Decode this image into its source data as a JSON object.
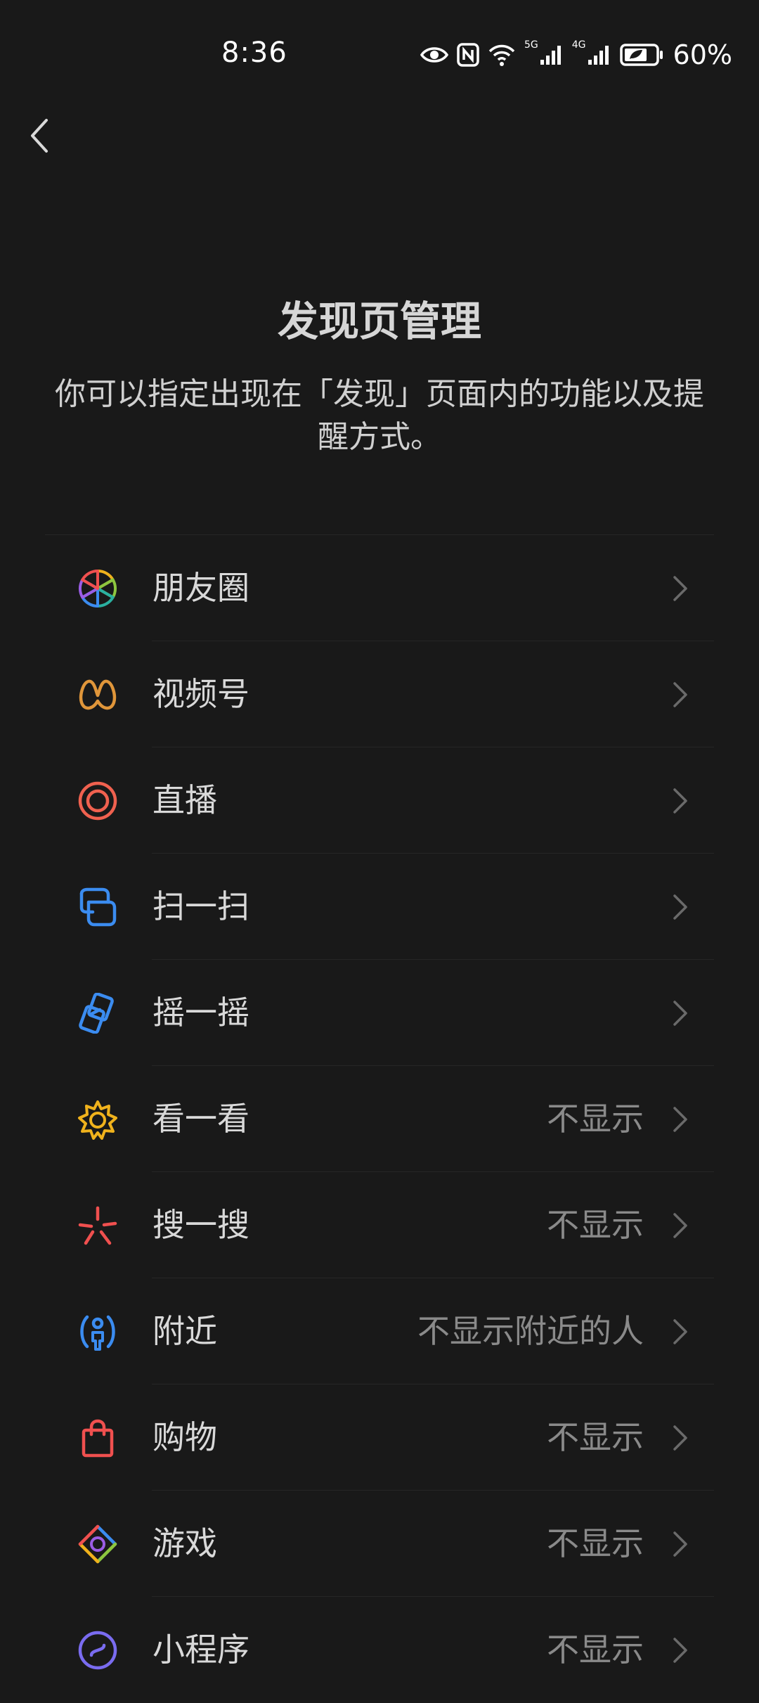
{
  "status_bar": {
    "time": "8:36",
    "battery_percent": "60%",
    "signal_1_label": "5G",
    "signal_2_label": "4G"
  },
  "header": {
    "title": "发现页管理",
    "description": "你可以指定出现在「发现」页面内的功能以及提醒方式。"
  },
  "items": [
    {
      "label": "朋友圈",
      "value": "",
      "icon": "moments-icon"
    },
    {
      "label": "视频号",
      "value": "",
      "icon": "channels-icon"
    },
    {
      "label": "直播",
      "value": "",
      "icon": "live-icon"
    },
    {
      "label": "扫一扫",
      "value": "",
      "icon": "scan-icon"
    },
    {
      "label": "摇一摇",
      "value": "",
      "icon": "shake-icon"
    },
    {
      "label": "看一看",
      "value": "不显示",
      "icon": "top-stories-icon"
    },
    {
      "label": "搜一搜",
      "value": "不显示",
      "icon": "search-icon"
    },
    {
      "label": "附近",
      "value": "不显示附近的人",
      "icon": "nearby-icon"
    },
    {
      "label": "购物",
      "value": "不显示",
      "icon": "shopping-icon"
    },
    {
      "label": "游戏",
      "value": "不显示",
      "icon": "games-icon"
    },
    {
      "label": "小程序",
      "value": "不显示",
      "icon": "mini-programs-icon"
    }
  ],
  "colors": {
    "background": "#191919",
    "text_primary": "#d9d9d9",
    "text_secondary": "#8a8a8a",
    "channels": "#e0963a",
    "live": "#f0614f",
    "scan": "#3b8cf0",
    "top_stories": "#f0b21c",
    "search": "#f0504f",
    "nearby": "#3b8cf0",
    "shopping": "#f0504f"
  }
}
